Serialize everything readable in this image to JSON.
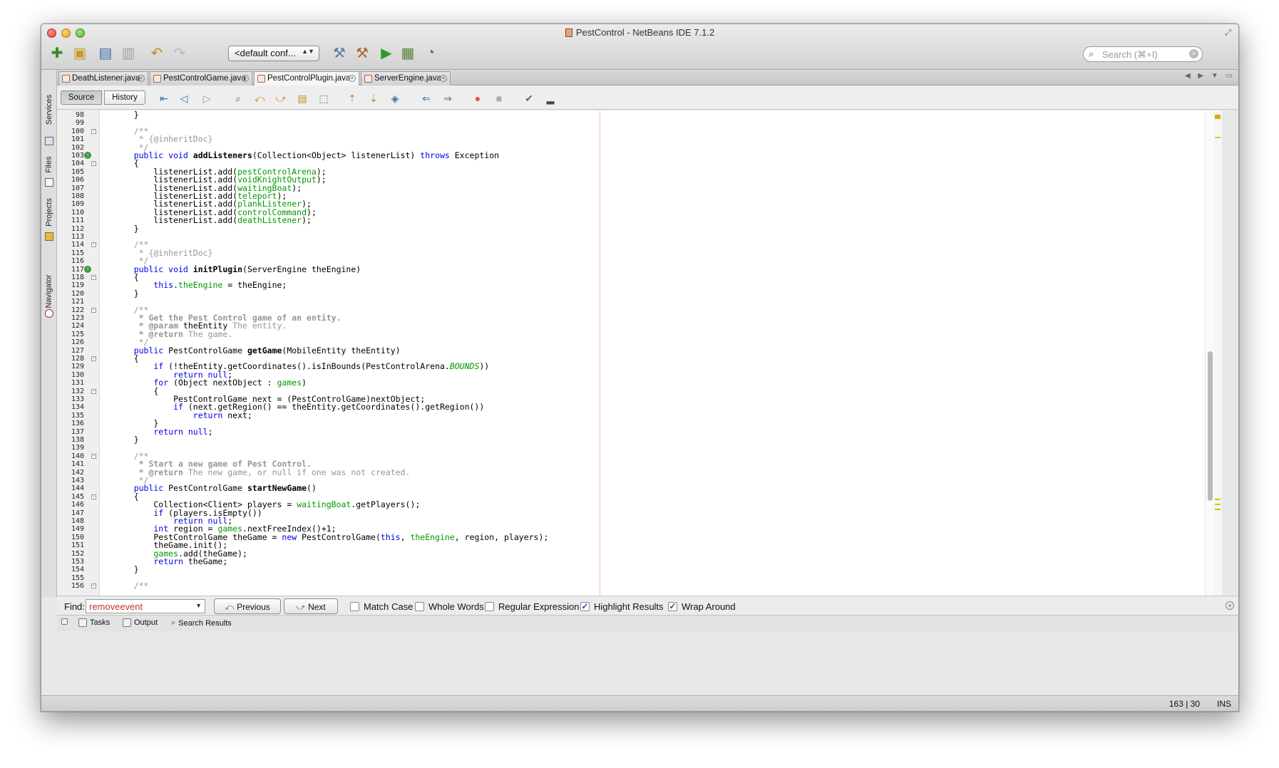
{
  "window": {
    "title": "PestControl - NetBeans IDE 7.1.2"
  },
  "toolbar": {
    "config_value": "<default conf...",
    "search_placeholder": "Search (⌘+I)",
    "icons": [
      "new-file-icon",
      "new-project-icon",
      "open-project-icon",
      "save-all-icon",
      "undo-icon",
      "redo-icon",
      "build-icon",
      "clean-build-icon",
      "run-icon",
      "debug-icon",
      "profile-icon"
    ]
  },
  "side_tabs": [
    "Services",
    "Files",
    "Projects",
    "Navigator"
  ],
  "tabs": [
    {
      "label": "DeathListener.java",
      "active": false
    },
    {
      "label": "PestControlGame.java",
      "active": false
    },
    {
      "label": "PestControlPlugin.java",
      "active": true
    },
    {
      "label": "ServerEngine.java",
      "active": false
    }
  ],
  "editor_toolbar": {
    "source_label": "Source",
    "history_label": "History"
  },
  "code": {
    "colors": {
      "keyword": "#0000e6",
      "field": "#009900",
      "comment": "#969696",
      "default": "#000000"
    },
    "lines": [
      {
        "n": "98",
        "segs": [
          [
            "d",
            "    }"
          ]
        ]
      },
      {
        "n": "99",
        "segs": []
      },
      {
        "n": "100",
        "segs": [
          [
            "c",
            "    /**"
          ]
        ]
      },
      {
        "n": "101",
        "segs": [
          [
            "c",
            "     * {@inheritDoc}"
          ]
        ]
      },
      {
        "n": "102",
        "segs": [
          [
            "c",
            "     */"
          ]
        ]
      },
      {
        "n": "103",
        "segs": [
          [
            "k",
            "    public void "
          ],
          [
            "b",
            "addListeners"
          ],
          [
            "d",
            "(Collection<Object> listenerList) "
          ],
          [
            "k",
            "throws"
          ],
          [
            "d",
            " Exception"
          ]
        ]
      },
      {
        "n": "104",
        "segs": [
          [
            "d",
            "    {"
          ]
        ]
      },
      {
        "n": "105",
        "segs": [
          [
            "d",
            "        listenerList.add("
          ],
          [
            "f",
            "pestControlArena"
          ],
          [
            "d",
            ");"
          ]
        ]
      },
      {
        "n": "106",
        "segs": [
          [
            "d",
            "        listenerList.add("
          ],
          [
            "f",
            "voidKnightOutput"
          ],
          [
            "d",
            ");"
          ]
        ]
      },
      {
        "n": "107",
        "segs": [
          [
            "d",
            "        listenerList.add("
          ],
          [
            "f",
            "waitingBoat"
          ],
          [
            "d",
            ");"
          ]
        ]
      },
      {
        "n": "108",
        "segs": [
          [
            "d",
            "        listenerList.add("
          ],
          [
            "f",
            "teleport"
          ],
          [
            "d",
            ");"
          ]
        ]
      },
      {
        "n": "109",
        "segs": [
          [
            "d",
            "        listenerList.add("
          ],
          [
            "f",
            "plankListener"
          ],
          [
            "d",
            ");"
          ]
        ]
      },
      {
        "n": "110",
        "segs": [
          [
            "d",
            "        listenerList.add("
          ],
          [
            "f",
            "controlCommand"
          ],
          [
            "d",
            ");"
          ]
        ]
      },
      {
        "n": "111",
        "segs": [
          [
            "d",
            "        listenerList.add("
          ],
          [
            "f",
            "deathListener"
          ],
          [
            "d",
            ");"
          ]
        ]
      },
      {
        "n": "112",
        "segs": [
          [
            "d",
            "    }"
          ]
        ]
      },
      {
        "n": "113",
        "segs": []
      },
      {
        "n": "114",
        "segs": [
          [
            "c",
            "    /**"
          ]
        ]
      },
      {
        "n": "115",
        "segs": [
          [
            "c",
            "     * {@inheritDoc}"
          ]
        ]
      },
      {
        "n": "116",
        "segs": [
          [
            "c",
            "     */"
          ]
        ]
      },
      {
        "n": "117",
        "segs": [
          [
            "k",
            "    public void "
          ],
          [
            "b",
            "initPlugin"
          ],
          [
            "d",
            "(ServerEngine theEngine)"
          ]
        ]
      },
      {
        "n": "118",
        "segs": [
          [
            "d",
            "    {"
          ]
        ]
      },
      {
        "n": "119",
        "segs": [
          [
            "k",
            "        this"
          ],
          [
            "d",
            "."
          ],
          [
            "f",
            "theEngine"
          ],
          [
            "d",
            " = theEngine;"
          ]
        ]
      },
      {
        "n": "120",
        "segs": [
          [
            "d",
            "    }"
          ]
        ]
      },
      {
        "n": "121",
        "segs": []
      },
      {
        "n": "122",
        "segs": [
          [
            "c",
            "    /**"
          ]
        ]
      },
      {
        "n": "123",
        "segs": [
          [
            "cb",
            "     * Get the Pest Control game of an entity."
          ]
        ]
      },
      {
        "n": "124",
        "segs": [
          [
            "cb",
            "     * @param "
          ],
          [
            "d",
            "theEntity"
          ],
          [
            "c",
            " The entity."
          ]
        ]
      },
      {
        "n": "125",
        "segs": [
          [
            "cb",
            "     * @return"
          ],
          [
            "c",
            " The game."
          ]
        ]
      },
      {
        "n": "126",
        "segs": [
          [
            "c",
            "     */"
          ]
        ]
      },
      {
        "n": "127",
        "segs": [
          [
            "k",
            "    public "
          ],
          [
            "d",
            "PestControlGame "
          ],
          [
            "b",
            "getGame"
          ],
          [
            "d",
            "(MobileEntity theEntity)"
          ]
        ]
      },
      {
        "n": "128",
        "segs": [
          [
            "d",
            "    {"
          ]
        ]
      },
      {
        "n": "129",
        "segs": [
          [
            "k",
            "        if"
          ],
          [
            "d",
            " (!theEntity.getCoordinates().isInBounds(PestControlArena."
          ],
          [
            "fi",
            "BOUNDS"
          ],
          [
            "d",
            "))"
          ]
        ]
      },
      {
        "n": "130",
        "segs": [
          [
            "k",
            "            return null"
          ],
          [
            "d",
            ";"
          ]
        ]
      },
      {
        "n": "131",
        "segs": [
          [
            "k",
            "        for"
          ],
          [
            "d",
            " (Object nextObject : "
          ],
          [
            "f",
            "games"
          ],
          [
            "d",
            ")"
          ]
        ]
      },
      {
        "n": "132",
        "segs": [
          [
            "d",
            "        {"
          ]
        ]
      },
      {
        "n": "133",
        "segs": [
          [
            "d",
            "            PestControlGame next = (PestControlGame)nextObject;"
          ]
        ]
      },
      {
        "n": "134",
        "segs": [
          [
            "k",
            "            if"
          ],
          [
            "d",
            " (next.getRegion() == theEntity.getCoordinates().getRegion())"
          ]
        ]
      },
      {
        "n": "135",
        "segs": [
          [
            "k",
            "                return"
          ],
          [
            "d",
            " next;"
          ]
        ]
      },
      {
        "n": "136",
        "segs": [
          [
            "d",
            "        }"
          ]
        ]
      },
      {
        "n": "137",
        "segs": [
          [
            "k",
            "        return null"
          ],
          [
            "d",
            ";"
          ]
        ]
      },
      {
        "n": "138",
        "segs": [
          [
            "d",
            "    }"
          ]
        ]
      },
      {
        "n": "139",
        "segs": []
      },
      {
        "n": "140",
        "segs": [
          [
            "c",
            "    /**"
          ]
        ]
      },
      {
        "n": "141",
        "segs": [
          [
            "cb",
            "     * Start a new game of Pest Control."
          ]
        ]
      },
      {
        "n": "142",
        "segs": [
          [
            "cb",
            "     * @return"
          ],
          [
            "c",
            " The new game, or null if one was not created."
          ]
        ]
      },
      {
        "n": "143",
        "segs": [
          [
            "c",
            "     */"
          ]
        ]
      },
      {
        "n": "144",
        "segs": [
          [
            "k",
            "    public "
          ],
          [
            "d",
            "PestControlGame "
          ],
          [
            "b",
            "startNewGame"
          ],
          [
            "d",
            "()"
          ]
        ]
      },
      {
        "n": "145",
        "segs": [
          [
            "d",
            "    {"
          ]
        ]
      },
      {
        "n": "146",
        "segs": [
          [
            "d",
            "        Collection<Client> players = "
          ],
          [
            "f",
            "waitingBoat"
          ],
          [
            "d",
            ".getPlayers();"
          ]
        ]
      },
      {
        "n": "147",
        "segs": [
          [
            "k",
            "        if"
          ],
          [
            "d",
            " (players.isEmpty())"
          ]
        ]
      },
      {
        "n": "148",
        "segs": [
          [
            "k",
            "            return null"
          ],
          [
            "d",
            ";"
          ]
        ]
      },
      {
        "n": "149",
        "segs": [
          [
            "k",
            "        int"
          ],
          [
            "d",
            " region = "
          ],
          [
            "f",
            "games"
          ],
          [
            "d",
            ".nextFreeIndex()+1;"
          ]
        ]
      },
      {
        "n": "150",
        "segs": [
          [
            "d",
            "        PestControlGame theGame = "
          ],
          [
            "k",
            "new"
          ],
          [
            "d",
            " PestControlGame("
          ],
          [
            "k",
            "this"
          ],
          [
            "d",
            ", "
          ],
          [
            "f",
            "theEngine"
          ],
          [
            "d",
            ", region, players);"
          ]
        ]
      },
      {
        "n": "151",
        "segs": [
          [
            "d",
            "        theGame.init();"
          ]
        ]
      },
      {
        "n": "152",
        "segs": [
          [
            "f",
            "        games"
          ],
          [
            "d",
            ".add(theGame);"
          ]
        ]
      },
      {
        "n": "153",
        "segs": [
          [
            "k",
            "        return"
          ],
          [
            "d",
            " theGame;"
          ]
        ]
      },
      {
        "n": "154",
        "segs": [
          [
            "d",
            "    }"
          ]
        ]
      },
      {
        "n": "155",
        "segs": []
      },
      {
        "n": "156",
        "segs": [
          [
            "c",
            "    /**"
          ]
        ]
      }
    ]
  },
  "find": {
    "label": "Find:",
    "value": "removeevent",
    "previous_label": "Previous",
    "next_label": "Next",
    "options": [
      {
        "label": "Match Case",
        "checked": false
      },
      {
        "label": "Whole Words",
        "checked": false
      },
      {
        "label": "Regular Expression",
        "checked": false
      },
      {
        "label": "Highlight Results",
        "checked": true
      },
      {
        "label": "Wrap Around",
        "checked": true
      }
    ]
  },
  "output_tabs": [
    "Tasks",
    "Output",
    "Search Results"
  ],
  "status": {
    "position": "163 | 30",
    "mode": "INS"
  }
}
